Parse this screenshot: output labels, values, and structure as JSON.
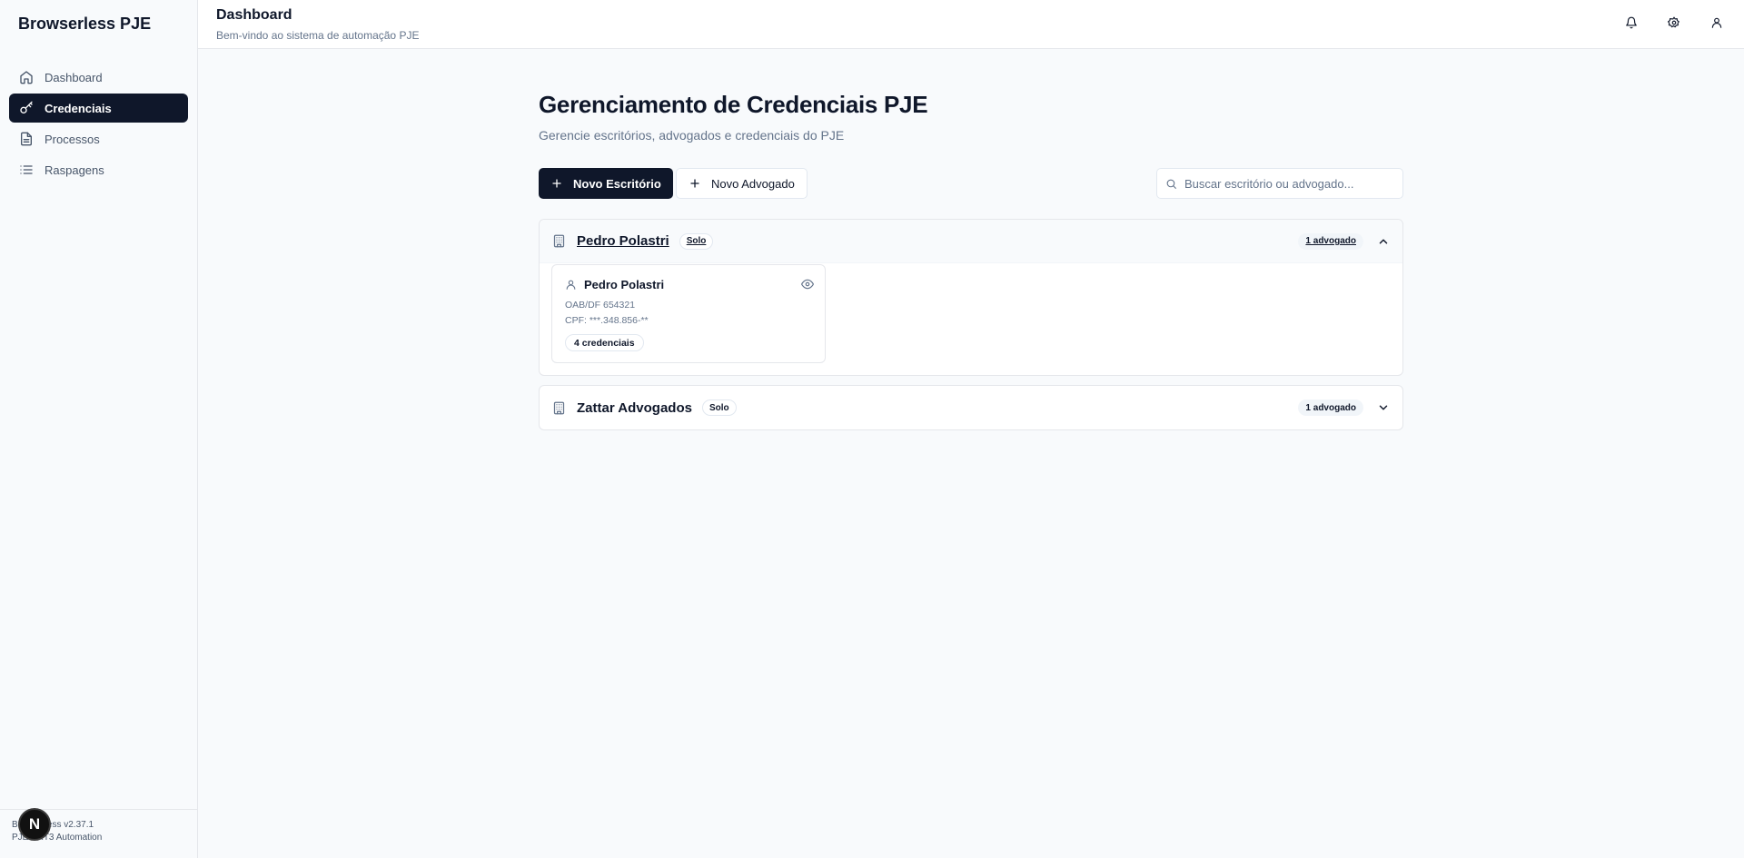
{
  "app": {
    "brand": "Browserless PJE"
  },
  "sidebar": {
    "items": [
      {
        "label": "Dashboard",
        "icon": "home-icon",
        "active": false
      },
      {
        "label": "Credenciais",
        "icon": "key-icon",
        "active": true
      },
      {
        "label": "Processos",
        "icon": "file-icon",
        "active": false
      },
      {
        "label": "Raspagens",
        "icon": "list-icon",
        "active": false
      }
    ],
    "footer_line1": "Browserless v2.37.1",
    "footer_line2": "PJE-TRT3 Automation",
    "dev_badge": "N"
  },
  "header": {
    "title": "Dashboard",
    "subtitle": "Bem-vindo ao sistema de automação PJE",
    "icons": [
      "bell-icon",
      "settings-icon",
      "user-icon"
    ]
  },
  "main": {
    "title": "Gerenciamento de Credenciais PJE",
    "subtitle": "Gerencie escritórios, advogados e credenciais do PJE",
    "new_office_label": "Novo Escritório",
    "new_lawyer_label": "Novo Advogado",
    "search_placeholder": "Buscar escritório ou advogado...",
    "search_value": ""
  },
  "offices": [
    {
      "name": "Pedro Polastri",
      "type_badge": "Solo",
      "count_badge": "1 advogado",
      "expanded": true,
      "lawyers": [
        {
          "name": "Pedro Polastri",
          "oab": "OAB/DF 654321",
          "cpf": "CPF: ***.348.856-**",
          "credentials_badge": "4 credenciais"
        }
      ]
    },
    {
      "name": "Zattar Advogados",
      "type_badge": "Solo",
      "count_badge": "1 advogado",
      "expanded": false,
      "lawyers": []
    }
  ],
  "colors": {
    "primary": "#0f172a",
    "muted": "#64748b",
    "border": "#e5e7eb",
    "background": "#f8fafc"
  }
}
